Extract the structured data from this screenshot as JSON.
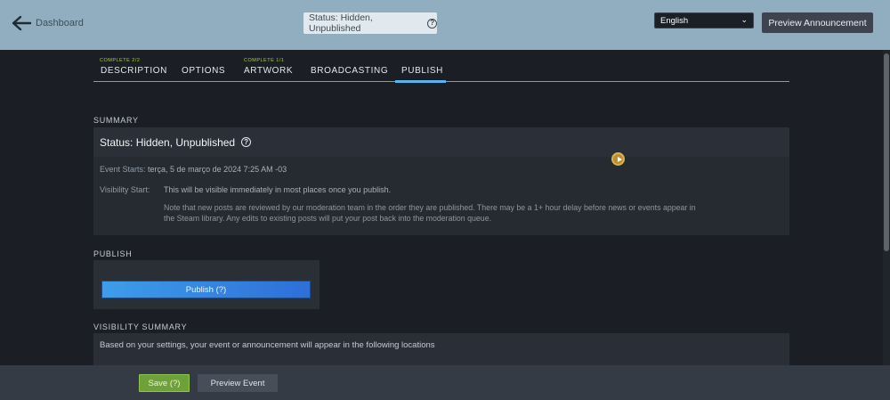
{
  "topbar": {
    "back_label": "Dashboard",
    "status_chip": "Status: Hidden, Unpublished",
    "help_glyph": "?",
    "language": "English",
    "preview_announcement": "Preview Announcement"
  },
  "tabs": [
    {
      "label": "DESCRIPTION",
      "sub": "COMPLETE 2/2"
    },
    {
      "label": "OPTIONS",
      "sub": ""
    },
    {
      "label": "ARTWORK",
      "sub": "COMPLETE 1/1"
    },
    {
      "label": "BROADCASTING",
      "sub": ""
    },
    {
      "label": "PUBLISH",
      "sub": ""
    }
  ],
  "summary": {
    "heading": "SUMMARY",
    "status": "Status: Hidden, Unpublished",
    "event_starts_label": "Event Starts:",
    "event_starts_value": "terça, 5 de março de 2024 7:25 AM -03",
    "visibility_start_label": "Visibility Start:",
    "visibility_start_value": "This will be visible immediately in most places once you publish.",
    "note": "Note that new posts are reviewed by our moderation team in the order they are published. There may be a 1+ hour delay before news or events appear in the Steam library. Any edits to existing posts will put your post back into the moderation queue."
  },
  "publish": {
    "heading": "PUBLISH",
    "button": "Publish (?)"
  },
  "visibility_summary": {
    "heading": "VISIBILITY SUMMARY",
    "text": "Based on your settings, your event or announcement will appear in the following locations"
  },
  "footer": {
    "save": "Save (?)",
    "preview_event": "Preview Event"
  },
  "colors": {
    "topbar": "#91aec0",
    "accent": "#5ab3ea",
    "save_green": "#6fa13a"
  }
}
